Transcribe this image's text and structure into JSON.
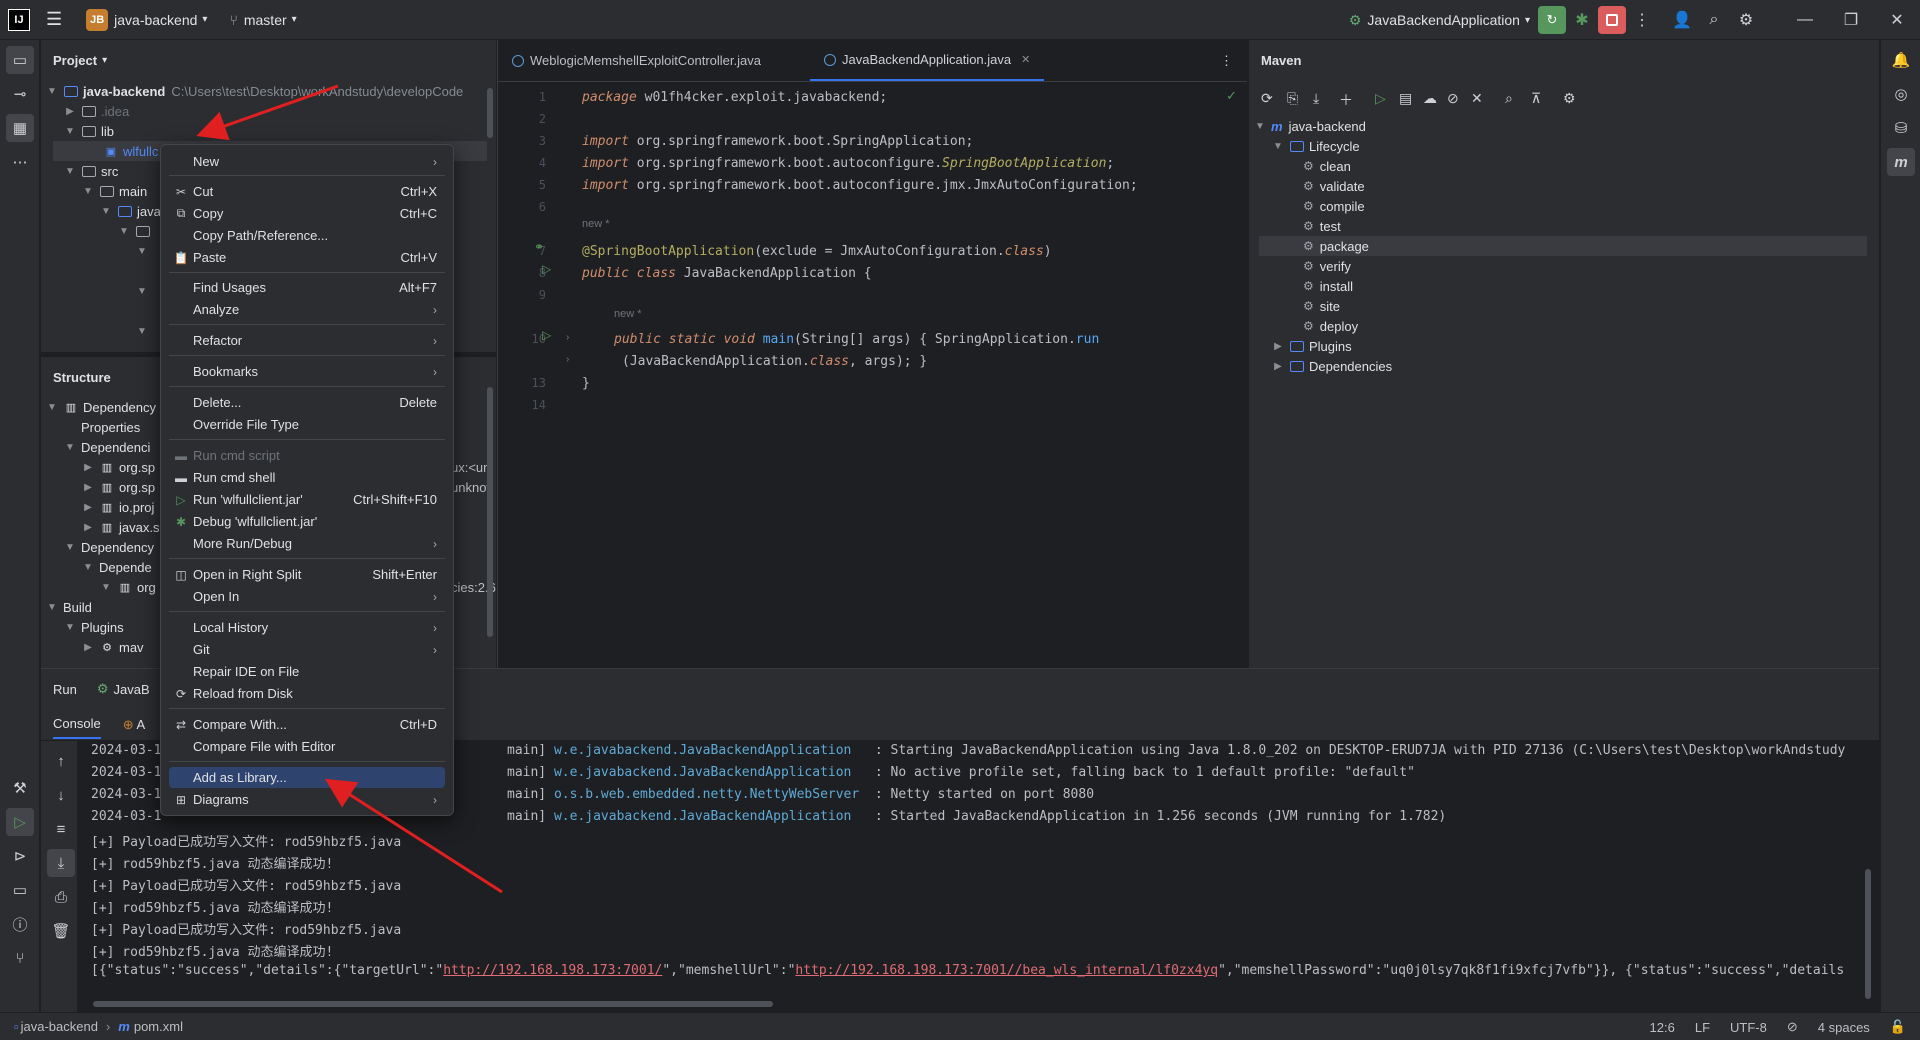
{
  "titlebar": {
    "logo": "IJ",
    "project_badge": "JB",
    "project": "java-backend",
    "branch": "master",
    "run_config": "JavaBackendApplication"
  },
  "project_panel": {
    "title": "Project",
    "tree": [
      {
        "label": "java-backend",
        "path": "C:\\Users\\test\\Desktop\\workAndstudy\\developCode"
      },
      {
        "label": ".idea"
      },
      {
        "label": "lib"
      },
      {
        "label": "wlfullc"
      },
      {
        "label": "src"
      },
      {
        "label": "main"
      },
      {
        "label": "java"
      }
    ]
  },
  "structure_panel": {
    "title": "Structure",
    "tree": [
      {
        "label": "Dependency"
      },
      {
        "label": "Properties"
      },
      {
        "label": "Dependenci"
      },
      {
        "label": "org.sp"
      },
      {
        "label": "org.sp"
      },
      {
        "label": "io.proj"
      },
      {
        "label": "javax.s"
      },
      {
        "label": "Dependency"
      },
      {
        "label": "Depende"
      },
      {
        "label": "org"
      },
      {
        "label": "Build"
      },
      {
        "label": "Plugins"
      },
      {
        "label": "mav"
      }
    ],
    "overflow_text": [
      "ux:<un",
      "unknov",
      "cies:2.6"
    ]
  },
  "editor": {
    "tabs": [
      {
        "label": "WeblogicMemshellExploitController.java",
        "active": false
      },
      {
        "label": "JavaBackendApplication.java",
        "active": true
      }
    ],
    "hints": [
      "new *",
      "new *"
    ],
    "lines": {
      "l1_kw": "package",
      "l1_rest": " w01fh4cker.exploit.javabackend;",
      "l3_kw": "import",
      "l3_rest": " org.springframework.boot.SpringApplication;",
      "l4_kw": "import",
      "l4_a": " org.springframework.boot.autoconfigure.",
      "l4_b": "SpringBootApplication",
      "l4_c": ";",
      "l5_kw": "import",
      "l5_rest": " org.springframework.boot.autoconfigure.jmx.JmxAutoConfiguration;",
      "l7_ann": "@SpringBootApplication",
      "l7_a": "(exclude = JmxAutoConfiguration.",
      "l7_kw": "class",
      "l7_b": ")",
      "l8_kw": "public class",
      "l8_rest": " JavaBackendApplication {",
      "l10_kw": "public static void",
      "l10_fn": " main",
      "l10_a": "(String[] args) { SpringApplication.",
      "l10_fn2": "run",
      "l11_a": "(JavaBackendApplication.",
      "l11_kw": "class",
      "l11_b": ", args); }",
      "l13": "}"
    },
    "line_numbers": [
      "1",
      "2",
      "3",
      "4",
      "5",
      "6",
      "7",
      "8",
      "9",
      "10",
      "",
      "13",
      "14"
    ]
  },
  "maven": {
    "title": "Maven",
    "root": "java-backend",
    "lifecycle": "Lifecycle",
    "goals": [
      "clean",
      "validate",
      "compile",
      "test",
      "package",
      "verify",
      "install",
      "site",
      "deploy"
    ],
    "plugins": "Plugins",
    "dependencies": "Dependencies"
  },
  "run": {
    "tab_run": "Run",
    "tab_app": "JavaB",
    "console": "Console",
    "console_tab2": "A",
    "log_dates": [
      "2024-03-1",
      "2024-03-1",
      "2024-03-1",
      "2024-03-1"
    ],
    "log_lines": [
      {
        "thread": "main]",
        "logger": "w.e.javabackend.JavaBackendApplication",
        "msg": ": Starting JavaBackendApplication using Java 1.8.0_202 on DESKTOP-ERUD7JA with PID 27136 (C:\\Users\\test\\Desktop\\workAndstudy"
      },
      {
        "thread": "main]",
        "logger": "w.e.javabackend.JavaBackendApplication",
        "msg": ": No active profile set, falling back to 1 default profile: \"default\""
      },
      {
        "thread": "main]",
        "logger": "o.s.b.web.embedded.netty.NettyWebServer",
        "msg": ": Netty started on port 8080"
      },
      {
        "thread": "main]",
        "logger": "w.e.javabackend.JavaBackendApplication",
        "msg": ": Started JavaBackendApplication in 1.256 seconds (JVM running for 1.782)"
      }
    ],
    "output": [
      "[+] Payload已成功写入文件: rod59hbzf5.java",
      "[+] rod59hbzf5.java 动态编译成功!",
      "[+] Payload已成功写入文件: rod59hbzf5.java",
      "[+] rod59hbzf5.java 动态编译成功!",
      "[+] Payload已成功写入文件: rod59hbzf5.java",
      "[+] rod59hbzf5.java 动态编译成功!"
    ],
    "json_prefix": "[{\"status\":\"success\",\"details\":{\"targetUrl\":\"",
    "json_url1": "http://192.168.198.173:7001/",
    "json_mid": "\",\"memshellUrl\":\"",
    "json_url2": "http://192.168.198.173:7001//bea_wls_internal/lf0zx4yq",
    "json_suffix": "\",\"memshellPassword\":\"uq0j0lsy7qk8f1fi9xfcj7vfb\"}}, {\"status\":\"success\",\"details"
  },
  "context_menu": {
    "items": [
      {
        "label": "New",
        "submenu": true
      },
      {
        "label": "Cut",
        "shortcut": "Ctrl+X",
        "icon": "cut-icon"
      },
      {
        "label": "Copy",
        "shortcut": "Ctrl+C",
        "icon": "copy-icon"
      },
      {
        "label": "Copy Path/Reference..."
      },
      {
        "label": "Paste",
        "shortcut": "Ctrl+V",
        "icon": "paste-icon"
      },
      {
        "label": "Find Usages",
        "shortcut": "Alt+F7"
      },
      {
        "label": "Analyze",
        "submenu": true
      },
      {
        "label": "Refactor",
        "submenu": true
      },
      {
        "label": "Bookmarks",
        "submenu": true
      },
      {
        "label": "Delete...",
        "shortcut": "Delete"
      },
      {
        "label": "Override File Type"
      },
      {
        "label": "Run cmd script",
        "disabled": true
      },
      {
        "label": "Run cmd shell"
      },
      {
        "label": "Run 'wlfullclient.jar'",
        "shortcut": "Ctrl+Shift+F10"
      },
      {
        "label": "Debug 'wlfullclient.jar'"
      },
      {
        "label": "More Run/Debug",
        "submenu": true
      },
      {
        "label": "Open in Right Split",
        "shortcut": "Shift+Enter"
      },
      {
        "label": "Open In",
        "submenu": true
      },
      {
        "label": "Local History",
        "submenu": true
      },
      {
        "label": "Git",
        "submenu": true
      },
      {
        "label": "Repair IDE on File"
      },
      {
        "label": "Reload from Disk"
      },
      {
        "label": "Compare With...",
        "shortcut": "Ctrl+D"
      },
      {
        "label": "Compare File with Editor"
      },
      {
        "label": "Add as Library...",
        "highlighted": true
      },
      {
        "label": "Diagrams",
        "submenu": true
      }
    ]
  },
  "statusbar": {
    "project": "java-backend",
    "file": "pom.xml",
    "position": "12:6",
    "line_sep": "LF",
    "encoding": "UTF-8",
    "indent": "4 spaces"
  },
  "colors": {
    "accent": "#3574f0",
    "run_green": "#57965c",
    "stop_red": "#db5c5c",
    "annotation_arrow": "#e02020"
  }
}
